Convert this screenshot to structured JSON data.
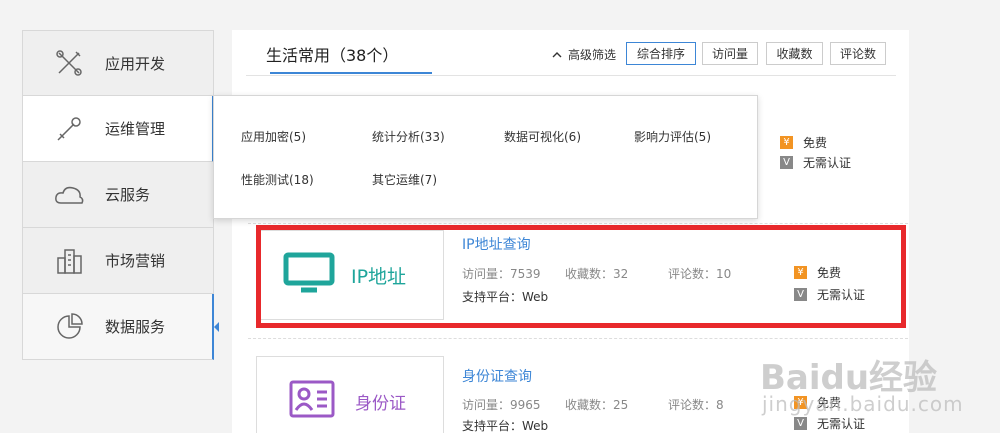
{
  "sidebar": {
    "items": [
      {
        "label": "应用开发",
        "icon": "tools-icon"
      },
      {
        "label": "运维管理",
        "icon": "wrench-icon"
      },
      {
        "label": "云服务",
        "icon": "cloud-icon"
      },
      {
        "label": "市场营销",
        "icon": "buildings-icon"
      },
      {
        "label": "数据服务",
        "icon": "pie-chart-icon"
      }
    ]
  },
  "tabs": {
    "title": "生活常用（38个）"
  },
  "filters": {
    "advanced_label": "高级筛选",
    "sort_options": [
      "综合排序",
      "访问量",
      "收藏数",
      "评论数"
    ],
    "active": "综合排序"
  },
  "dropdown": {
    "items": [
      "应用加密(5)",
      "统计分析(33)",
      "数据可视化(6)",
      "影响力评估(5)",
      "性能测试(18)",
      "其它运维(7)"
    ]
  },
  "cards": [
    {
      "thumb_text": "IP地址",
      "title": "IP地址查询",
      "visits_label": "访问量：7539",
      "favorites_label": "收藏数：32",
      "comments_label": "评论数：10",
      "platform_label": "支持平台：Web",
      "price": "免费",
      "auth": "无需认证"
    },
    {
      "thumb_text": "身份证",
      "title": "身份证查询",
      "visits_label": "访问量：9965",
      "favorites_label": "收藏数：25",
      "comments_label": "评论数：8",
      "platform_label": "支持平台：Web",
      "price": "免费",
      "auth": "无需认证"
    }
  ],
  "hidden_card": {
    "price": "免费",
    "auth": "无需认证"
  },
  "badges": {
    "free_symbol": "¥",
    "v_symbol": "V"
  },
  "watermark": {
    "main": "Baidu经验",
    "sub": "jingyan.baidu.com"
  },
  "colors": {
    "accent": "#3d86d6",
    "highlight": "#e8292c",
    "ip_icon": "#1fa59b",
    "id_icon": "#9b59c6",
    "free_badge": "#f29423"
  }
}
